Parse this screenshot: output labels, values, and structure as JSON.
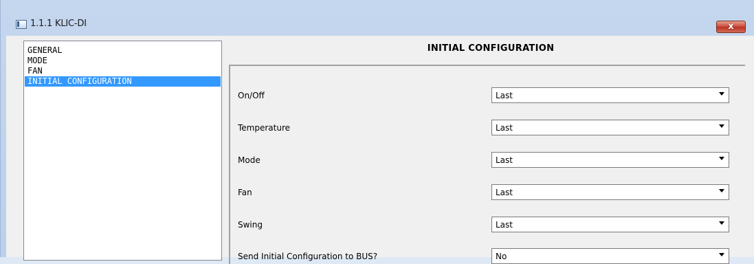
{
  "window": {
    "title": "1.1.1 KLIC-DI",
    "close_label": "x"
  },
  "sidebar": {
    "items": [
      {
        "label": "GENERAL"
      },
      {
        "label": "MODE"
      },
      {
        "label": "FAN"
      },
      {
        "label": "INITIAL CONFIGURATION",
        "selected": true
      }
    ]
  },
  "panel": {
    "title": "INITIAL CONFIGURATION",
    "params": [
      {
        "label": "On/Off",
        "value": "Last"
      },
      {
        "label": "Temperature",
        "value": "Last"
      },
      {
        "label": "Mode",
        "value": "Last"
      },
      {
        "label": "Fan",
        "value": "Last"
      },
      {
        "label": "Swing",
        "value": "Last"
      },
      {
        "label": "Send Initial Configuration to BUS?",
        "value": "No"
      }
    ]
  },
  "colors": {
    "selection": "#3399ff",
    "close_button": "#c9493a"
  },
  "icons": [
    "app-window-icon",
    "close-icon",
    "dropdown-arrow-icon"
  ]
}
